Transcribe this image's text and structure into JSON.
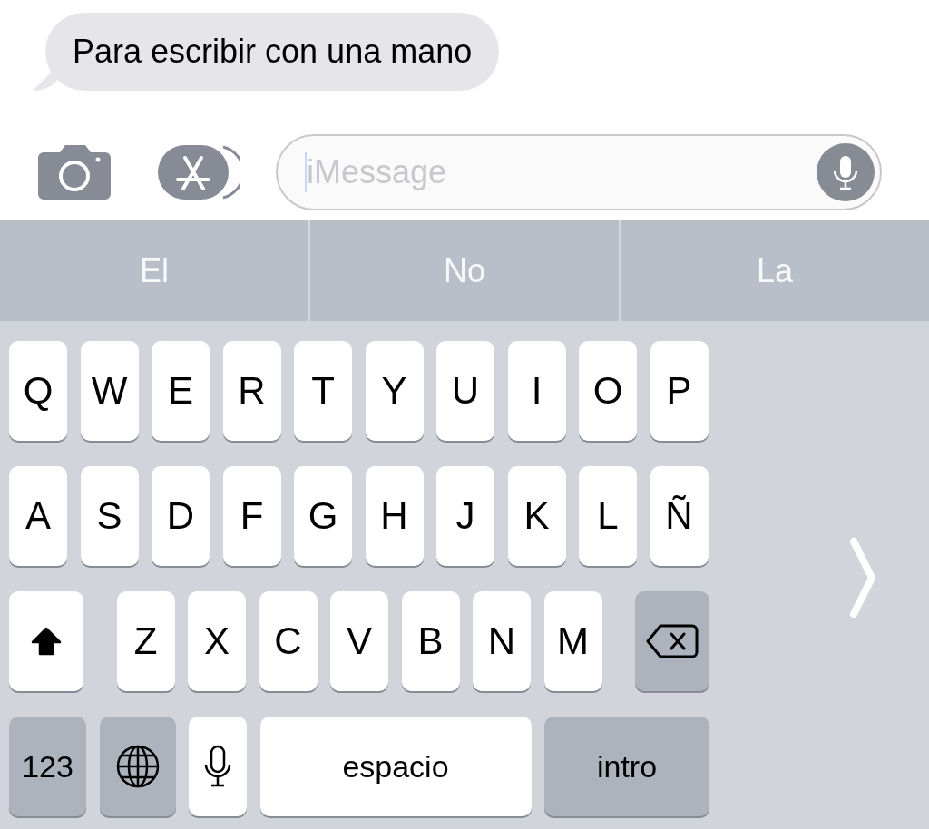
{
  "message": {
    "text": "Para escribir con una mano"
  },
  "compose": {
    "placeholder": "iMessage"
  },
  "suggestions": [
    {
      "label": "El"
    },
    {
      "label": "No"
    },
    {
      "label": "La"
    }
  ],
  "keyboard": {
    "rows": [
      {
        "keys": [
          {
            "kind": "letter",
            "label": "Q"
          },
          {
            "kind": "letter",
            "label": "W"
          },
          {
            "kind": "letter",
            "label": "E"
          },
          {
            "kind": "letter",
            "label": "R"
          },
          {
            "kind": "letter",
            "label": "T"
          },
          {
            "kind": "letter",
            "label": "Y"
          },
          {
            "kind": "letter",
            "label": "U"
          },
          {
            "kind": "letter",
            "label": "I"
          },
          {
            "kind": "letter",
            "label": "O"
          },
          {
            "kind": "letter",
            "label": "P"
          }
        ]
      },
      {
        "keys": [
          {
            "kind": "letter",
            "label": "A"
          },
          {
            "kind": "letter",
            "label": "S"
          },
          {
            "kind": "letter",
            "label": "D"
          },
          {
            "kind": "letter",
            "label": "F"
          },
          {
            "kind": "letter",
            "label": "G"
          },
          {
            "kind": "letter",
            "label": "H"
          },
          {
            "kind": "letter",
            "label": "J"
          },
          {
            "kind": "letter",
            "label": "K"
          },
          {
            "kind": "letter",
            "label": "L"
          },
          {
            "kind": "letter",
            "label": "Ñ"
          }
        ]
      },
      {
        "keys": [
          {
            "kind": "shift",
            "on": true
          },
          {
            "kind": "letter",
            "label": "Z"
          },
          {
            "kind": "letter",
            "label": "X"
          },
          {
            "kind": "letter",
            "label": "C"
          },
          {
            "kind": "letter",
            "label": "V"
          },
          {
            "kind": "letter",
            "label": "B"
          },
          {
            "kind": "letter",
            "label": "N"
          },
          {
            "kind": "letter",
            "label": "M"
          },
          {
            "kind": "delete"
          }
        ]
      },
      {
        "keys": [
          {
            "kind": "mode",
            "label": "123"
          },
          {
            "kind": "globe"
          },
          {
            "kind": "mic"
          },
          {
            "kind": "space",
            "label": "espacio"
          },
          {
            "kind": "return",
            "label": "intro"
          }
        ]
      }
    ]
  }
}
